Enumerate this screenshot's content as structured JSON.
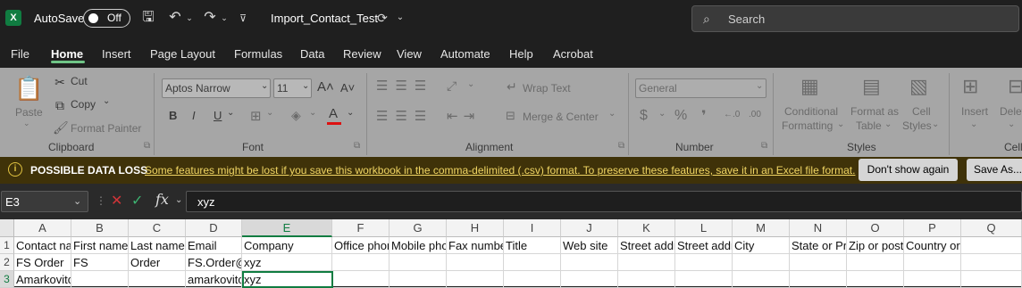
{
  "title_bar": {
    "app_icon": "X",
    "autosave_label": "AutoSave",
    "autosave_state": "Off",
    "file_name": "Import_Contact_Test",
    "search_placeholder": "Search"
  },
  "menu": [
    "File",
    "Home",
    "Insert",
    "Page Layout",
    "Formulas",
    "Data",
    "Review",
    "View",
    "Automate",
    "Help",
    "Acrobat"
  ],
  "ribbon": {
    "clipboard": {
      "paste": "Paste",
      "cut": "Cut",
      "copy": "Copy",
      "format_painter": "Format Painter",
      "group": "Clipboard"
    },
    "font": {
      "font_name": "Aptos Narrow",
      "font_size": "11",
      "group": "Font"
    },
    "alignment": {
      "wrap_text": "Wrap Text",
      "merge_center": "Merge & Center",
      "group": "Alignment"
    },
    "number": {
      "format": "General",
      "group": "Number"
    },
    "styles": {
      "conditional": "Conditional",
      "formatting": "Formatting",
      "format_as": "Format as",
      "table": "Table",
      "cell": "Cell",
      "styles": "Styles",
      "group": "Styles"
    },
    "cells": {
      "insert": "Insert",
      "delete": "Delete",
      "group": "Cells"
    }
  },
  "infobar": {
    "title": "POSSIBLE DATA LOSS",
    "message": "Some features might be lost if you save this workbook in the comma-delimited (.csv) format. To preserve these features, save it in an Excel file format.",
    "dont_show": "Don't show again",
    "save_as": "Save As..."
  },
  "formula_bar": {
    "name_box": "E3",
    "formula": "xyz"
  },
  "columns": [
    "A",
    "B",
    "C",
    "D",
    "E",
    "F",
    "G",
    "H",
    "I",
    "J",
    "K",
    "L",
    "M",
    "N",
    "O",
    "P",
    "Q"
  ],
  "rows": [
    [
      "Contact name",
      "First name",
      "Last name",
      "Email",
      "Company",
      "Office phone",
      "Mobile phone",
      "Fax number",
      "Title",
      "Web site",
      "Street address",
      "Street address",
      "City",
      "State or Province",
      "Zip or postal code",
      "Country or region",
      ""
    ],
    [
      "FS Order",
      "FS",
      "Order",
      "FS.Order@",
      "xyz",
      "",
      "",
      "",
      "",
      "",
      "",
      "",
      "",
      "",
      "",
      "",
      ""
    ],
    [
      "Amarkovitch",
      "",
      "",
      "amarkovitch",
      "xyz",
      "",
      "",
      "",
      "",
      "",
      "",
      "",
      "",
      "",
      "",
      "",
      ""
    ]
  ]
}
